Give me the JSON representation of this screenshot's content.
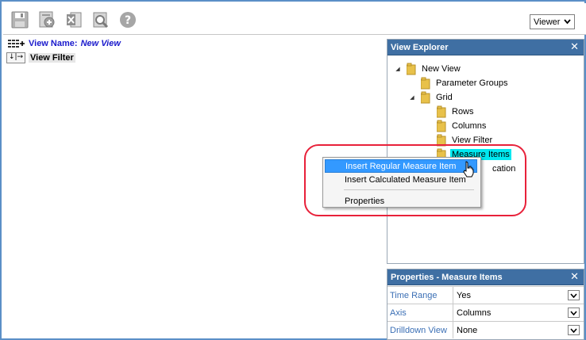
{
  "toolbar": {
    "buttons": [
      {
        "name": "save-icon"
      },
      {
        "name": "add-view-icon"
      },
      {
        "name": "excel-export-icon"
      },
      {
        "name": "preview-icon"
      },
      {
        "name": "help-icon"
      }
    ],
    "mode_select": {
      "value": "Viewer"
    }
  },
  "view": {
    "name_label": "View Name:",
    "name_value": "New View",
    "filter_label": "View Filter",
    "filter_icon_text": "↓|→"
  },
  "explorer": {
    "title": "View Explorer",
    "close": "✕",
    "tree": {
      "root": "New View",
      "parameter_groups": "Parameter Groups",
      "grid": "Grid",
      "rows": "Rows",
      "columns": "Columns",
      "view_filter": "View Filter",
      "measure_items": "Measure Items",
      "partial_item": "cation"
    }
  },
  "context_menu": {
    "items": [
      {
        "label": "Insert Regular Measure Item"
      },
      {
        "label": "Insert Calculated Measure Item"
      },
      {
        "label": "Properties"
      }
    ]
  },
  "properties": {
    "title": "Properties - Measure Items",
    "close": "✕",
    "rows": [
      {
        "name": "Time Range",
        "value": "Yes"
      },
      {
        "name": "Axis",
        "value": "Columns"
      },
      {
        "name": "Drilldown View",
        "value": "None"
      }
    ]
  },
  "colors": {
    "panel_header": "#3f6fa3",
    "selected_highlight": "#00e8f0",
    "menu_hover": "#3399ff",
    "callout": "#e8213a",
    "link_blue": "#1a1acc"
  }
}
